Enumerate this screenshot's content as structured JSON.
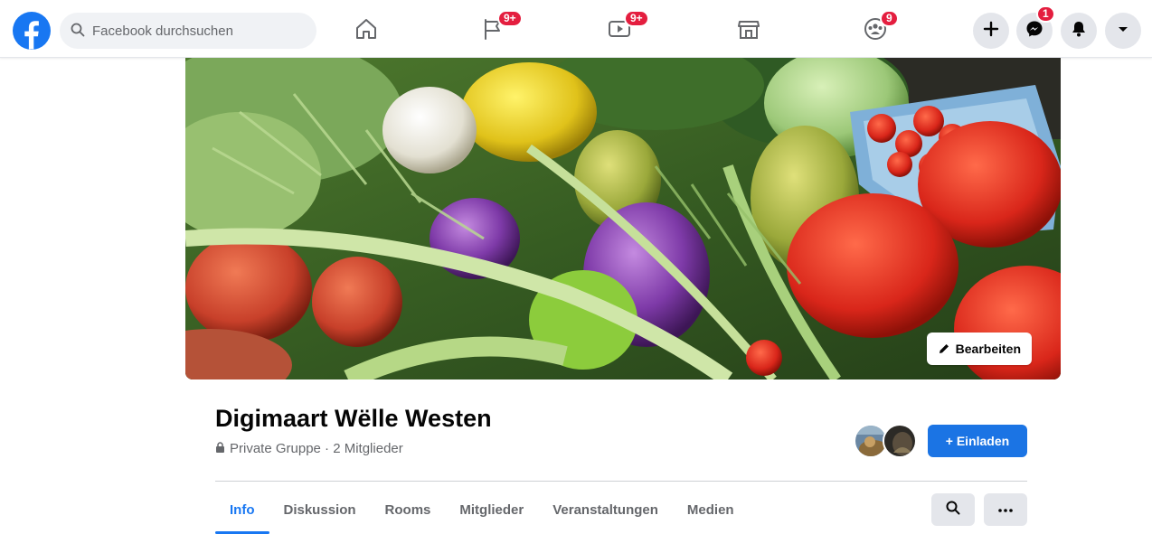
{
  "topbar": {
    "logo_icon": "facebook-logo",
    "search": {
      "placeholder": "Facebook durchsuchen",
      "value": ""
    },
    "nav": [
      {
        "name": "home",
        "icon": "home-icon",
        "badge": ""
      },
      {
        "name": "pages",
        "icon": "flag-icon",
        "badge": "9+"
      },
      {
        "name": "watch",
        "icon": "video-icon",
        "badge": "9+"
      },
      {
        "name": "marketplace",
        "icon": "store-icon",
        "badge": ""
      },
      {
        "name": "groups",
        "icon": "groups-icon",
        "badge": "9"
      }
    ],
    "actions": [
      {
        "name": "create",
        "icon": "plus-icon",
        "badge": ""
      },
      {
        "name": "messenger",
        "icon": "messenger-icon",
        "badge": "1"
      },
      {
        "name": "notifications",
        "icon": "bell-icon",
        "badge": ""
      },
      {
        "name": "account",
        "icon": "caret-down-icon",
        "badge": ""
      }
    ]
  },
  "cover": {
    "edit_label": "Bearbeiten"
  },
  "group": {
    "name": "Digimaart Wëlle Westen",
    "meta": "Private Gruppe · 2 Mitglieder",
    "invite_label": "+ Einladen"
  },
  "tabs": [
    "Info",
    "Diskussion",
    "Rooms",
    "Mitglieder",
    "Veranstaltungen",
    "Medien"
  ],
  "active_tab": "Info",
  "colors": {
    "brand": "#1877f2",
    "badge": "#e41e3f",
    "invite": "#1b74e4"
  }
}
